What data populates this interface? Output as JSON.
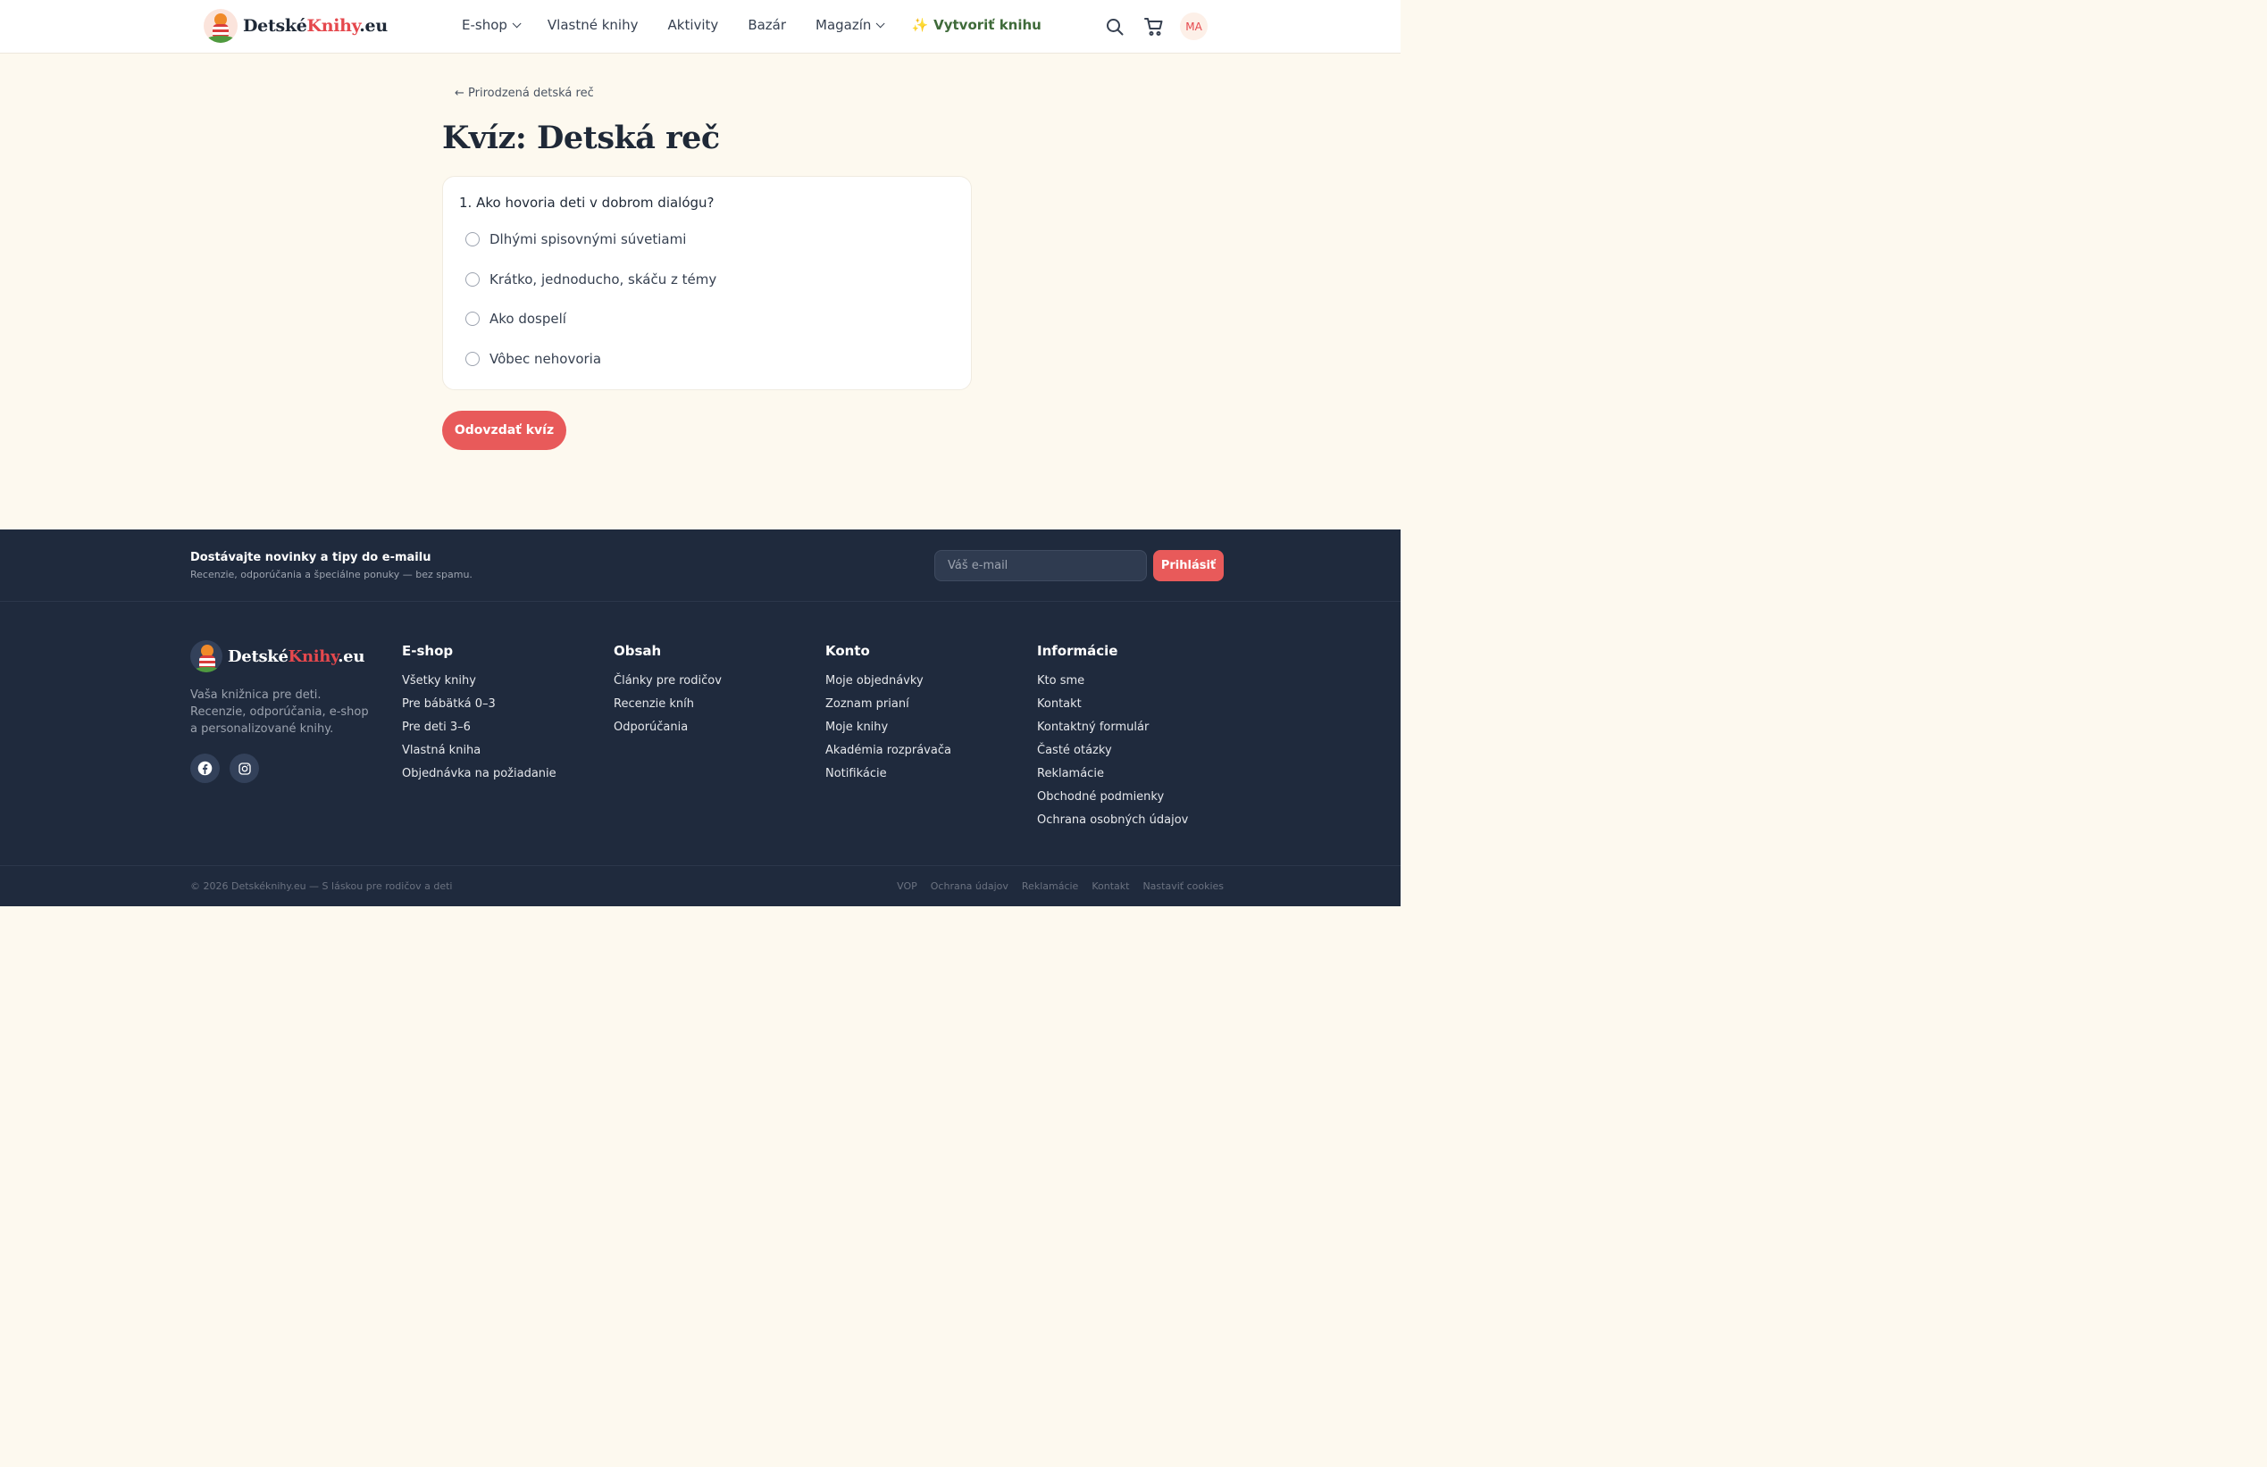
{
  "header": {
    "logo": {
      "part1": "Detské",
      "part2": "Knihy",
      "part3": ".eu"
    },
    "nav": [
      {
        "label": "E-shop",
        "dropdown": true
      },
      {
        "label": "Vlastné knihy",
        "dropdown": false
      },
      {
        "label": "Aktivity",
        "dropdown": false
      },
      {
        "label": "Bazár",
        "dropdown": false
      },
      {
        "label": "Magazín",
        "dropdown": true
      },
      {
        "label": "Vytvoriť knihu",
        "dropdown": false
      }
    ],
    "create_icon": "✨",
    "avatar_initials": "MA",
    "icons": [
      "search-icon",
      "cart-icon"
    ]
  },
  "main": {
    "back_link": "← Prirodzená detská reč",
    "title": "Kvíz: Detská reč",
    "question": "1. Ako hovoria deti v dobrom dialógu?",
    "options": [
      "Dlhými spisovnými súvetiami",
      "Krátko, jednoducho, skáču z témy",
      "Ako dospelí",
      "Vôbec nehovoria"
    ],
    "submit_label": "Odovzdať kvíz"
  },
  "footer": {
    "newsletter": {
      "title": "Dostávajte novinky a tipy do e-mailu",
      "subtitle": "Recenzie, odporúčania a špeciálne ponuky — bez spamu.",
      "placeholder": "Váš e-mail",
      "button": "Prihlásiť"
    },
    "logo": {
      "part1": "Detské",
      "part2": "Knihy",
      "part3": ".eu"
    },
    "description": "Vaša knižnica pre deti. Recenzie, odporúčania, e-shop a personalizované knihy.",
    "columns": [
      {
        "title": "E-shop",
        "links": [
          "Všetky knihy",
          "Pre bábätká 0–3",
          "Pre deti 3–6",
          "Vlastná kniha",
          "Objednávka na požiadanie"
        ]
      },
      {
        "title": "Obsah",
        "links": [
          "Články pre rodičov",
          "Recenzie kníh",
          "Odporúčania"
        ]
      },
      {
        "title": "Konto",
        "links": [
          "Moje objednávky",
          "Zoznam prianí",
          "Moje knihy",
          "Akadémia rozprávača",
          "Notifikácie"
        ]
      },
      {
        "title": "Informácie",
        "links": [
          "Kto sme",
          "Kontakt",
          "Kontaktný formulár",
          "Časté otázky",
          "Reklamácie",
          "Obchodné podmienky",
          "Ochrana osobných údajov"
        ]
      }
    ],
    "copyright": "© 2026 Detskéknihy.eu — S láskou pre rodičov a deti",
    "legal": [
      "VOP",
      "Ochrana údajov",
      "Reklamácie",
      "Kontakt",
      "Nastaviť cookies"
    ]
  },
  "colors": {
    "accent": "#e85a5a",
    "page_bg": "#fdf9ef",
    "footer_bg": "#1f2a3d",
    "create_link": "#3f6b3a"
  }
}
